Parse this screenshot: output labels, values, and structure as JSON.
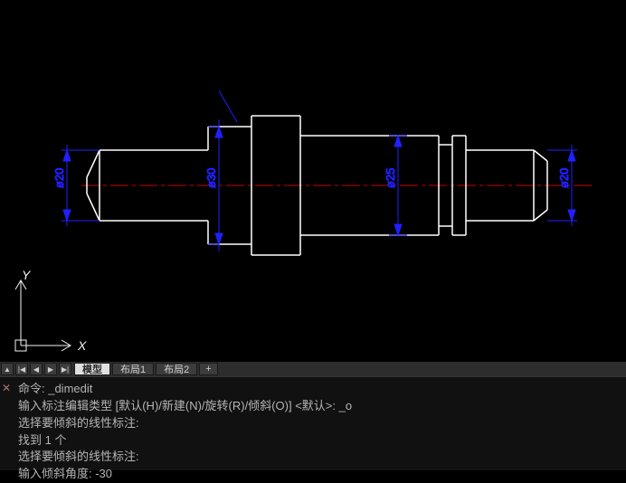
{
  "drawing": {
    "dimensions": {
      "d1": "ø20",
      "d2": "ø30",
      "d3": "ø25",
      "d4": "ø20"
    },
    "ucs": {
      "x": "X",
      "y": "Y"
    }
  },
  "tabs": {
    "model": "模型",
    "layout1": "布局1",
    "layout2": "布局2"
  },
  "cmd": {
    "l1": "命令: _dimedit",
    "l2": "输入标注编辑类型 [默认(H)/新建(N)/旋转(R)/倾斜(O)] <默认>: _o",
    "l3": "选择要倾斜的线性标注:",
    "l4": "找到 1 个",
    "l5": "选择要倾斜的线性标注:",
    "l6": "输入倾斜角度: -30"
  }
}
